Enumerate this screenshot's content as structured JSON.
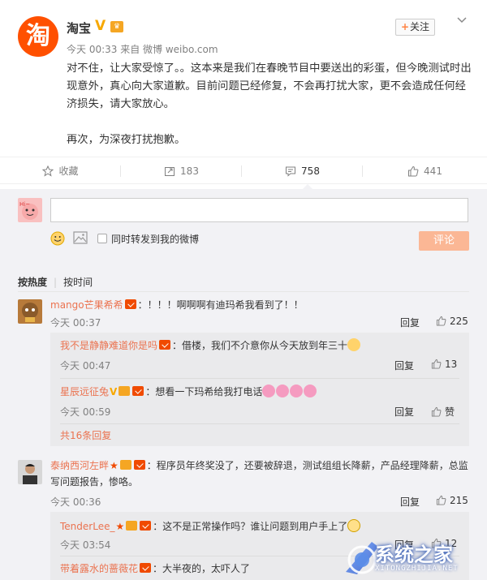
{
  "post": {
    "author": "淘宝",
    "avatar_char": "淘",
    "verified_icon": "verified-v-icon",
    "meta": "今天 00:33 来自 微博 weibo.com",
    "follow_label": "关注",
    "follow_plus": "+",
    "paragraph1": "对不住，让大家受惊了。。这本来是我们在春晚节目中要送出的彩蛋，但今晚测试时出现意外，真心向大家道歉。目前问题已经修复，不会再打扰大家，更不会造成任何经济损失，请大家放心。",
    "paragraph2": "再次，为深夜打扰抱歉。"
  },
  "actions": {
    "favorite": "收藏",
    "repost": "183",
    "comment": "758",
    "like": "441"
  },
  "composer": {
    "sync_label": "同时转发到我的微博",
    "submit_label": "评论"
  },
  "sort": {
    "hot": "按热度",
    "time": "按时间"
  },
  "comments": [
    {
      "user": "mango芒果希希",
      "text": "：！！！啊啊啊有迪玛希我看到了！！",
      "time": "今天 00:37",
      "reply": "回复",
      "likes": "225",
      "replies": [
        {
          "user": "我不是静静难道你是吗",
          "text": "：借楼，我们不介意你从今天放到年三十",
          "time": "今天 00:47",
          "reply": "回复",
          "likes": "13"
        },
        {
          "user": "星辰远征兔",
          "text": "：想看一下玛希给我打电话",
          "time": "今天 00:59",
          "reply": "回复",
          "likes": "赞"
        }
      ],
      "more": "共16条回复"
    },
    {
      "user": "泰纳西河左畔",
      "text": "：程序员年终奖没了，还要被辞退，测试组组长降薪，产品经理降薪，总监写问题报告，惨咯。",
      "time": "今天 00:36",
      "reply": "回复",
      "likes": "215",
      "replies": [
        {
          "user": "TenderLee_",
          "text": "：这不是正常操作吗？谁让问题到用户手上了",
          "time": "今天 03:54",
          "reply": "回复",
          "likes": "12"
        },
        {
          "user": "带着露水的蔷薇花",
          "text": "：大半夜的，太吓人了",
          "time": "",
          "reply": "",
          "likes": ""
        }
      ]
    }
  ],
  "watermark": {
    "text": "系统之家",
    "sub": "XITONGZHIJIA.NET"
  },
  "colors": {
    "accent": "#eb7350",
    "brand": "#ff5000",
    "submit_disabled": "#fbb795",
    "comment_bg": "#f2f2f5"
  }
}
